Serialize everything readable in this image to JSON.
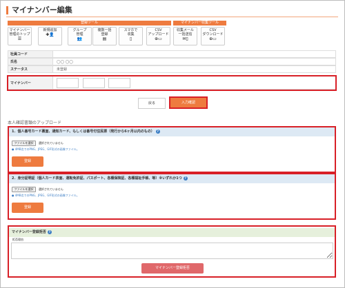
{
  "page_title": "マイナンバー編集",
  "tool_groups": [
    {
      "label": "登録ツール"
    },
    {
      "label": "マイナンバー収集ツール"
    }
  ],
  "tools": [
    {
      "label1": "マイナンバー",
      "label2": "管理のトップ",
      "icon": "☰",
      "icon_name": "list-icon"
    },
    {
      "label1": "新規追加",
      "label2": "",
      "icon": "✚👤",
      "icon_name": "add-user-icon"
    },
    {
      "label1": "グループ",
      "label2": "管理",
      "icon": "👥",
      "icon_name": "group-icon"
    },
    {
      "label1": "複数一括",
      "label2": "登録",
      "icon": "▤",
      "icon_name": "bulk-register-icon"
    },
    {
      "label1": "スマホで",
      "label2": "収集",
      "icon": "▯",
      "icon_name": "smartphone-icon"
    },
    {
      "label1": "CSV",
      "label2": "アップロード",
      "icon": "⊕▭",
      "icon_name": "upload-icon"
    },
    {
      "label1": "収集メール",
      "label2": "一括送信",
      "icon": "✉▯",
      "icon_name": "mail-icon"
    },
    {
      "label1": "CSV",
      "label2": "ダウンロード",
      "icon": "⊕▭",
      "icon_name": "download-icon"
    }
  ],
  "rows": {
    "employee_code": {
      "label": "社員コード",
      "value": ""
    },
    "name": {
      "label": "氏名",
      "value": "◯◯ ◯◯"
    },
    "status": {
      "label": "ステータス",
      "value": "未登録"
    },
    "my_number": {
      "label": "マイナンバー"
    }
  },
  "buttons": {
    "back": "戻る",
    "confirm": "入力確認"
  },
  "upload_section_title": "本人確認書類のアップロード",
  "section1": {
    "title": "1．個人番号カード裏面、通知カード、もしくは番号付住民票（発行から6ヶ月以内のもの）",
    "file_button": "ファイルを選択",
    "file_status": "選択されていません",
    "note": "● 4MB迄でのPNG、JPEG、GIF形式の画像ファイル。",
    "register": "登録"
  },
  "section2": {
    "title": "2．身分証明証（個人カード表面、運転免許証、パスポート、各種保険証、各種福祉手帳、等）※いずれか1つ",
    "file_button": "ファイルを選択",
    "file_status": "選択されていません",
    "note": "● 4MB迄でのPNG、JPEG、GIF形式の画像ファイル。",
    "register": "登録"
  },
  "section3": {
    "title": "マイナンバー登録拒否",
    "reason_label": "拒否理由",
    "reason_value": "",
    "delete_button": "マイナンバー登録拒否"
  },
  "colors": {
    "accent": "#ee7b3f",
    "highlight": "#d81f26",
    "info": "#3b7dc4",
    "danger_btn": "#e0686a"
  }
}
